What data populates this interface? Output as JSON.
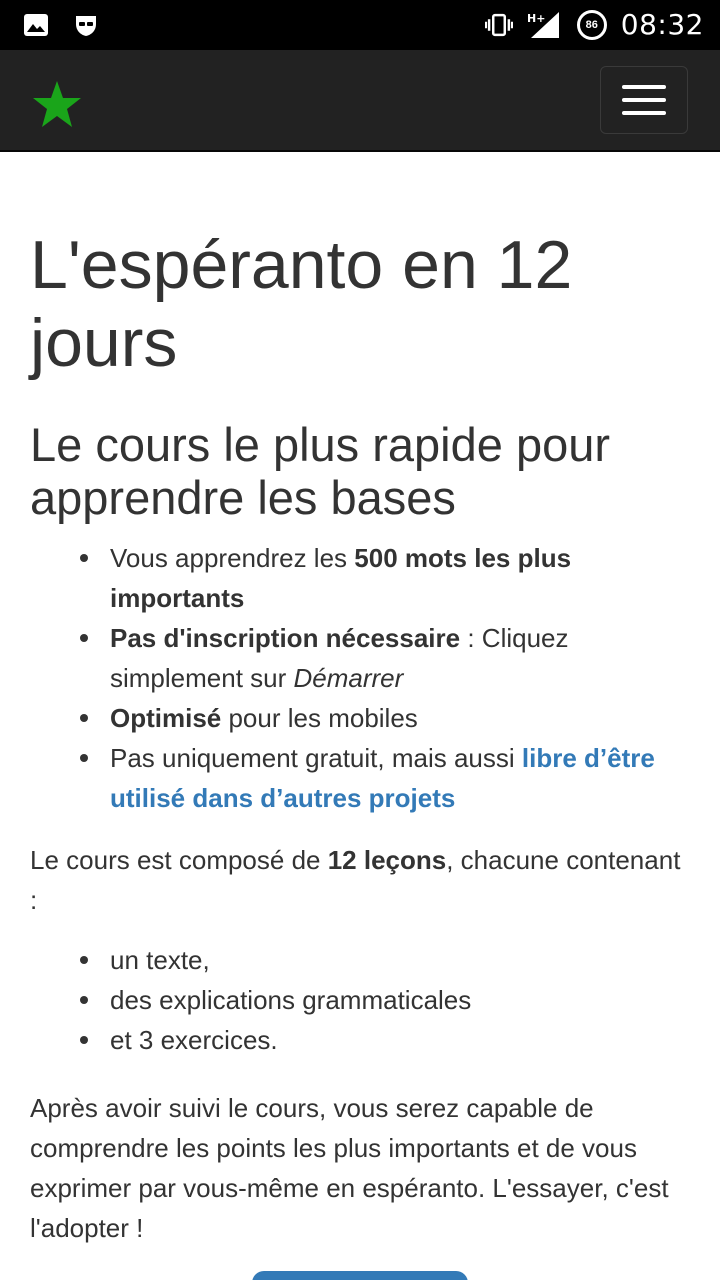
{
  "status_bar": {
    "time": "08:32",
    "battery_level": "86",
    "network": "H+",
    "icons": [
      "image-icon",
      "incognito-icon",
      "vibrate-icon",
      "signal-icon",
      "battery-icon"
    ]
  },
  "navbar": {
    "brand_icon": "green-star-icon",
    "brand_color": "#1aa51a",
    "menu_icon": "hamburger-icon"
  },
  "main": {
    "title": "L'espéranto en 12 jours",
    "subtitle": "Le cours le plus rapide pour apprendre les bases",
    "features": [
      {
        "t1": "Vous apprendrez les ",
        "b1": "500 mots les plus importants"
      },
      {
        "b1": "Pas d'inscription nécessaire",
        "t1": " : Cliquez simplement sur ",
        "i1": "Démarrer"
      },
      {
        "b1": "Optimisé",
        "t1": " pour les mobiles"
      },
      {
        "t1": "Pas uniquement gratuit, mais aussi ",
        "link": "libre d’être utilisé dans d’autres projets"
      }
    ],
    "course_intro": {
      "t1": "Le cours est composé de ",
      "b1": "12 leçons",
      "t2": ", chacune contenant :"
    },
    "lesson_contents": [
      "un texte,",
      "des explications grammaticales",
      "et 3 exercices."
    ],
    "closing": "Après avoir suivi le cours, vous serez capable de comprendre les points les plus importants et de vous exprimer par vous-même en espéranto. L'essayer, c'est l'adopter !"
  },
  "colors": {
    "link": "#337ab7",
    "navbar_bg": "#222222",
    "text": "#333333",
    "button": "#337ab7"
  }
}
